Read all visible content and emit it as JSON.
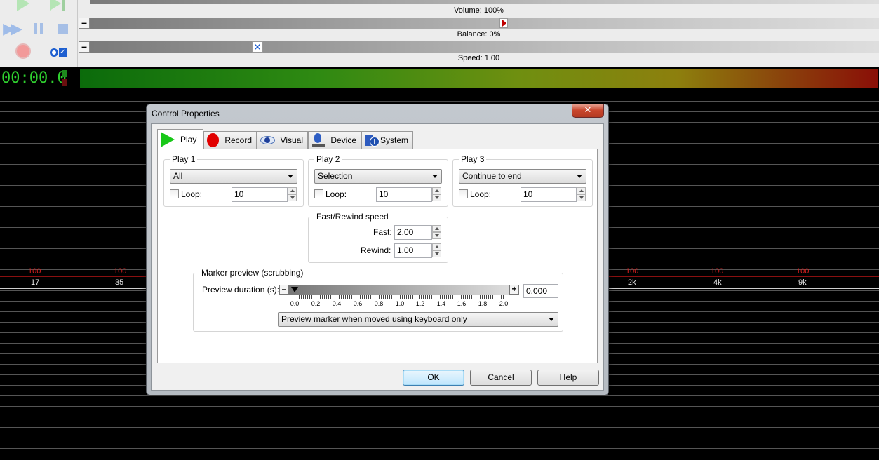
{
  "background_app": {
    "sliders": {
      "volume_caption": "Volume: 100%",
      "balance_caption": "Balance: 0%",
      "speed_caption": "Speed: 1.00",
      "minus_glyph": "–",
      "speed_thumb_glyph": "✕"
    },
    "time_display": "00:00.0",
    "spectrum": {
      "values": [
        "100",
        "100",
        "100",
        "100",
        "100"
      ],
      "freqs": [
        "17",
        "35",
        "2k",
        "4k",
        "9k"
      ]
    },
    "colors": {
      "time_text": "#2fd02f",
      "spectrum_value": "#e02020"
    }
  },
  "dialog": {
    "title": "Control Properties",
    "close_glyph": "✕",
    "tabs": [
      {
        "label": "Play",
        "icon": "play-icon",
        "active": true
      },
      {
        "label": "Record",
        "icon": "record-icon"
      },
      {
        "label": "Visual",
        "icon": "eye-icon"
      },
      {
        "label": "Device",
        "icon": "microphone-icon"
      },
      {
        "label": "System",
        "icon": "system-info-icon"
      }
    ],
    "play_groups": [
      {
        "title_prefix": "Play ",
        "title_num": "1",
        "mode": "All",
        "loop_label": "Loop:",
        "loop_checked": false,
        "loop_count": "10"
      },
      {
        "title_prefix": "Play ",
        "title_num": "2",
        "mode": "Selection",
        "loop_label": "Loop:",
        "loop_checked": false,
        "loop_count": "10"
      },
      {
        "title_prefix": "Play ",
        "title_num": "3",
        "mode": "Continue to end",
        "loop_label": "Loop:",
        "loop_checked": false,
        "loop_count": "10"
      }
    ],
    "fast_rewind": {
      "title": "Fast/Rewind speed",
      "fast_label": "Fast:",
      "fast_value": "2.00",
      "rewind_label": "Rewind:",
      "rewind_value": "1.00"
    },
    "marker_preview": {
      "title": "Marker preview (scrubbing)",
      "duration_label": "Preview duration (s):",
      "duration_value": "0.000",
      "minus_glyph": "–",
      "plus_glyph": "+",
      "scale_labels": [
        "0.0",
        "0.2",
        "0.4",
        "0.6",
        "0.8",
        "1.0",
        "1.2",
        "1.4",
        "1.6",
        "1.8",
        "2.0"
      ],
      "mode": "Preview marker when moved using keyboard only"
    },
    "buttons": {
      "ok": "OK",
      "cancel": "Cancel",
      "help": "Help"
    }
  }
}
